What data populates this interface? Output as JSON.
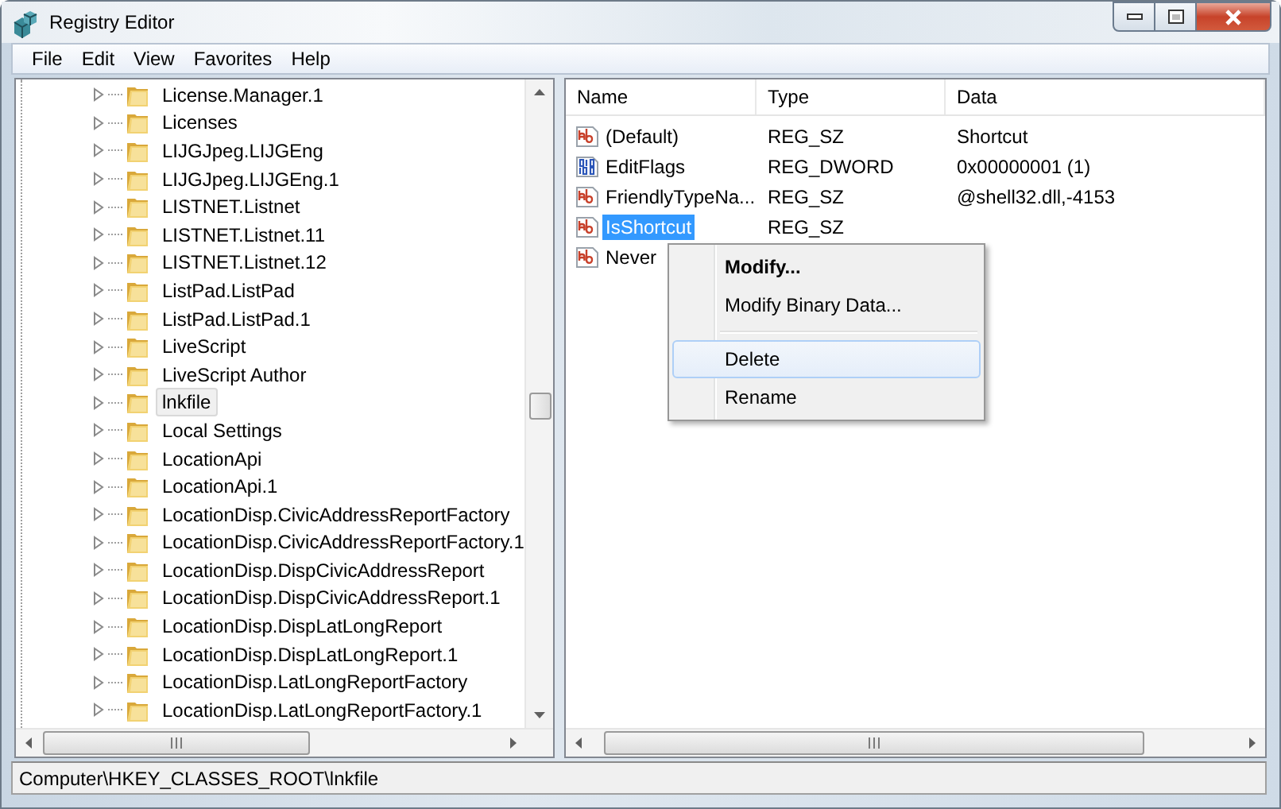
{
  "window": {
    "title": "Registry Editor"
  },
  "menu": [
    "File",
    "Edit",
    "View",
    "Favorites",
    "Help"
  ],
  "tree": {
    "items": [
      {
        "label": "License.Manager.1",
        "selected": false
      },
      {
        "label": "Licenses",
        "selected": false
      },
      {
        "label": "LIJGJpeg.LIJGEng",
        "selected": false
      },
      {
        "label": "LIJGJpeg.LIJGEng.1",
        "selected": false
      },
      {
        "label": "LISTNET.Listnet",
        "selected": false
      },
      {
        "label": "LISTNET.Listnet.11",
        "selected": false
      },
      {
        "label": "LISTNET.Listnet.12",
        "selected": false
      },
      {
        "label": "ListPad.ListPad",
        "selected": false
      },
      {
        "label": "ListPad.ListPad.1",
        "selected": false
      },
      {
        "label": "LiveScript",
        "selected": false
      },
      {
        "label": "LiveScript Author",
        "selected": false
      },
      {
        "label": "lnkfile",
        "selected": true
      },
      {
        "label": "Local Settings",
        "selected": false
      },
      {
        "label": "LocationApi",
        "selected": false
      },
      {
        "label": "LocationApi.1",
        "selected": false
      },
      {
        "label": "LocationDisp.CivicAddressReportFactory",
        "selected": false
      },
      {
        "label": "LocationDisp.CivicAddressReportFactory.1",
        "selected": false
      },
      {
        "label": "LocationDisp.DispCivicAddressReport",
        "selected": false
      },
      {
        "label": "LocationDisp.DispCivicAddressReport.1",
        "selected": false
      },
      {
        "label": "LocationDisp.DispLatLongReport",
        "selected": false
      },
      {
        "label": "LocationDisp.DispLatLongReport.1",
        "selected": false
      },
      {
        "label": "LocationDisp.LatLongReportFactory",
        "selected": false
      },
      {
        "label": "LocationDisp.LatLongReportFactory.1",
        "selected": false
      }
    ]
  },
  "values": {
    "columns": [
      "Name",
      "Type",
      "Data"
    ],
    "rows": [
      {
        "kind": "string",
        "name": "(Default)",
        "type": "REG_SZ",
        "data": "Shortcut",
        "selected": false
      },
      {
        "kind": "binary",
        "name": "EditFlags",
        "type": "REG_DWORD",
        "data": "0x00000001 (1)",
        "selected": false
      },
      {
        "kind": "string",
        "name": "FriendlyTypeNa...",
        "type": "REG_SZ",
        "data": "@shell32.dll,-4153",
        "selected": false
      },
      {
        "kind": "string",
        "name": "IsShortcut",
        "type": "REG_SZ",
        "selected": true
      },
      {
        "kind": "string",
        "name": "Never",
        "selected": false
      }
    ]
  },
  "context_menu": {
    "items": [
      {
        "kind": "default",
        "label": "Modify...",
        "hovered": false
      },
      {
        "kind": "item",
        "label": "Modify Binary Data...",
        "hovered": false
      },
      {
        "kind": "separator"
      },
      {
        "kind": "item",
        "label": "Delete",
        "hovered": true
      },
      {
        "kind": "item",
        "label": "Rename",
        "hovered": false
      }
    ]
  },
  "status_bar": "Computer\\HKEY_CLASSES_ROOT\\lnkfile"
}
